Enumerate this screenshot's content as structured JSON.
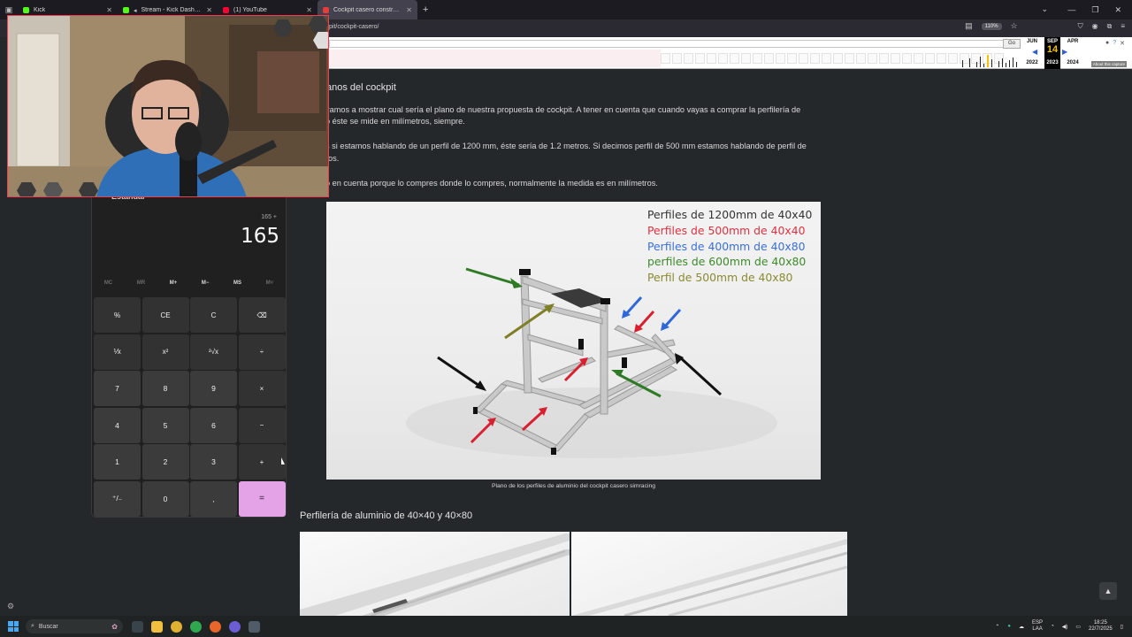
{
  "browser": {
    "tabs": [
      {
        "title": "Kick",
        "favicon_color": "#53fc18"
      },
      {
        "title": "Stream - Kick Dashboard",
        "favicon_color": "#53fc18"
      },
      {
        "title": "(1) YouTube",
        "favicon_color": "#ff0033"
      },
      {
        "title": "Cockpit casero construye tu",
        "favicon_color": "#e63c3c"
      }
    ],
    "url": "pit/cockpit-casero/",
    "zoom": "110%"
  },
  "wayback": {
    "go_label": "Go",
    "months": [
      "JUN",
      "SEP",
      "APR"
    ],
    "day": "14",
    "years": [
      "2022",
      "2023",
      "2024"
    ],
    "about": "About this capture"
  },
  "article": {
    "heading": "anos del cockpit",
    "paragraphs": [
      "vamos a mostrar cual sería el plano de nuestra propuesta de cockpit. A tener en cuenta que cuando vayas a comprar la perfilería de",
      "o éste se mide en milímetros, siempre.",
      "s si estamos hablando de un perfil de 1200 mm, éste sería de 1.2 metros. Si decimos perfil de 500 mm estamos hablando de perfil de",
      "ros.",
      "o en cuenta porque lo compres donde lo compres, normalmente la medida es en milímetros."
    ],
    "figure_legend": [
      {
        "text": "Perfiles de 1200mm de 40x40",
        "color": "#333333"
      },
      {
        "text": "Perfiles de 500mm de 40x40",
        "color": "#e03040"
      },
      {
        "text": "Perfiles de 400mm de 40x80",
        "color": "#3a6fd8"
      },
      {
        "text": "perfiles de 600mm de 40x80",
        "color": "#3d8a2a"
      },
      {
        "text": "Perfil de 500mm de 40x80",
        "color": "#8a8a30"
      }
    ],
    "caption": "Plano de los perfiles de aluminio del cockpit casero simracing",
    "subheading": "Perfilería de aluminio de 40×40 y 40×80"
  },
  "calculator": {
    "mode": "Estándar",
    "expression": "165 +",
    "display": "165",
    "memory": [
      "MC",
      "MR",
      "M+",
      "M−",
      "MS",
      "M˅"
    ],
    "keys": [
      "%",
      "CE",
      "C",
      "⌫",
      "⅟x",
      "x²",
      "²√x",
      "÷",
      "7",
      "8",
      "9",
      "×",
      "4",
      "5",
      "6",
      "−",
      "1",
      "2",
      "3",
      "+",
      "⁺/₋",
      "0",
      ",",
      "="
    ]
  },
  "taskbar": {
    "search_placeholder": "Buscar",
    "lang_top": "ESP",
    "lang_bottom": "LAA",
    "time": "18:25",
    "date": "22/7/2025"
  }
}
